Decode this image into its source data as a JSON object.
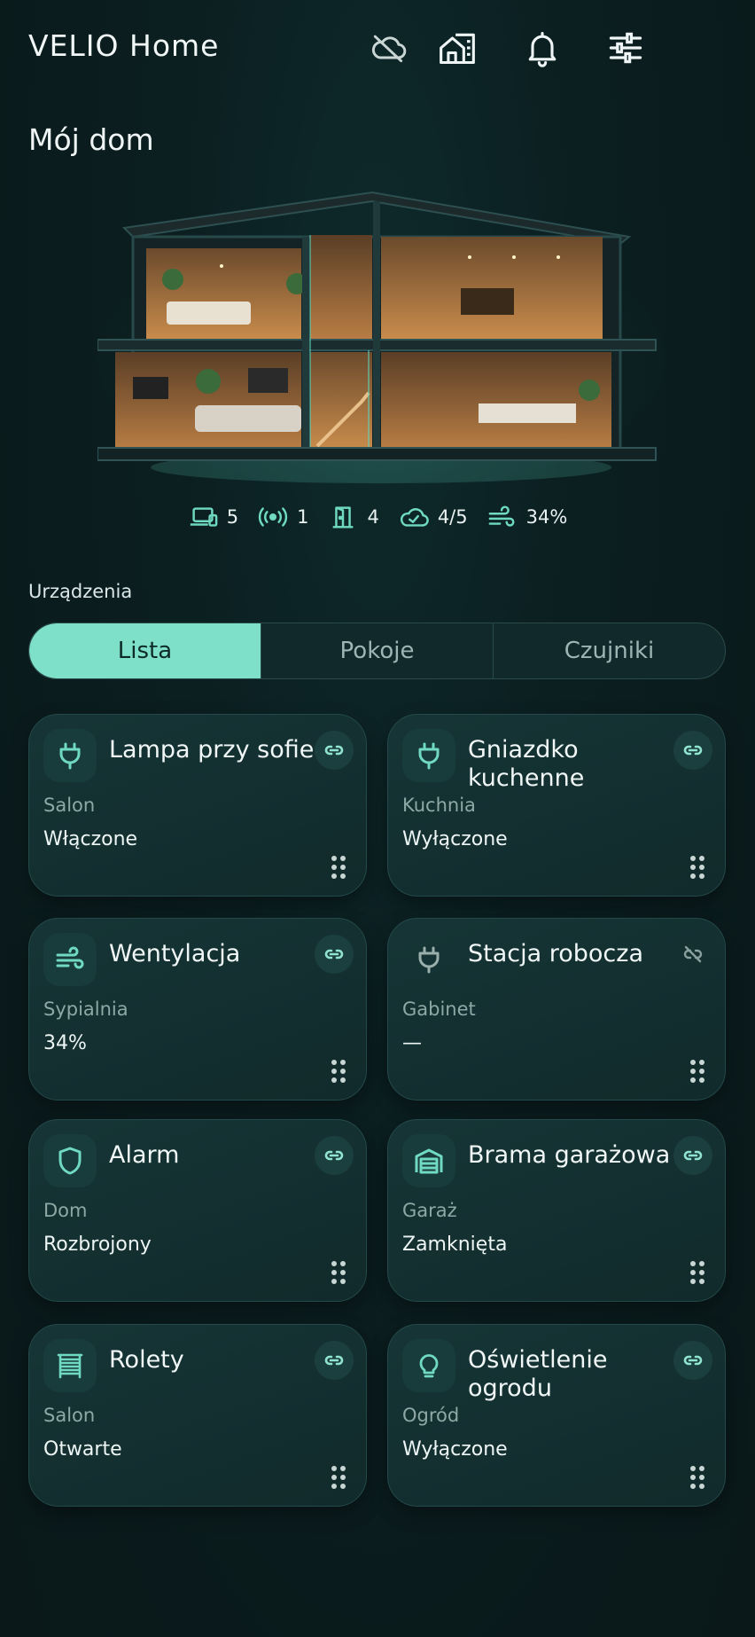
{
  "header": {
    "app_title": "VELIO Home",
    "icons": [
      "cloud-off-icon",
      "home-building-icon",
      "bell-icon",
      "sliders-icon"
    ]
  },
  "page_title": "Mój dom",
  "stats": [
    {
      "icon": "devices-icon",
      "value": "5"
    },
    {
      "icon": "broadcast-icon",
      "value": "1"
    },
    {
      "icon": "door-icon",
      "value": "4"
    },
    {
      "icon": "cloud-check-icon",
      "value": "4/5"
    },
    {
      "icon": "wind-icon",
      "value": "34%"
    }
  ],
  "devices_section": {
    "label": "Urządzenia",
    "tabs": [
      "Lista",
      "Pokoje",
      "Czujniki"
    ],
    "active_tab": "Lista"
  },
  "devices": [
    {
      "name": "Lampa przy sofie",
      "room": "Salon",
      "state": "Włączone",
      "icon": "plug-icon",
      "linked": true
    },
    {
      "name": "Gniazdko kuchenne",
      "room": "Kuchnia",
      "state": "Wyłączone",
      "icon": "plug-icon",
      "linked": true
    },
    {
      "name": "Wentylacja",
      "room": "Sypialnia",
      "state": "34%",
      "icon": "wind-icon",
      "linked": true
    },
    {
      "name": "Stacja robocza",
      "room": "Gabinet",
      "state": "—",
      "icon": "plug-icon",
      "linked": false
    },
    {
      "name": "Alarm",
      "room": "Dom",
      "state": "Rozbrojony",
      "icon": "shield-icon",
      "linked": true
    },
    {
      "name": "Brama garażowa",
      "room": "Garaż",
      "state": "Zamknięta",
      "icon": "garage-icon",
      "linked": true
    },
    {
      "name": "Rolety",
      "room": "Salon",
      "state": "Otwarte",
      "icon": "blinds-icon",
      "linked": true
    },
    {
      "name": "Oświetlenie ogrodu",
      "room": "Ogród",
      "state": "Wyłączone",
      "icon": "bulb-icon",
      "linked": true
    }
  ],
  "colors": {
    "accent": "#7ee0c8",
    "background": "#0b1e20",
    "card": "#143233"
  }
}
